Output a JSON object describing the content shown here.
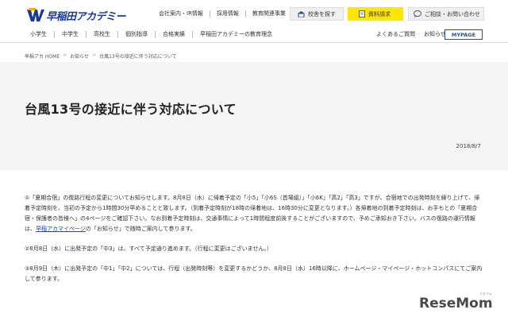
{
  "header": {
    "logo_text": "早稲田アカデミー",
    "top_links": [
      "会社案内・IR情報",
      "採用情報",
      "教育関連事業"
    ],
    "school_search_label": "校舎を探す",
    "material_label": "資料請求",
    "contact_label": "ご相談・お問い合わせ"
  },
  "nav": {
    "items": [
      "小学生",
      "中学生",
      "高校生",
      "個別指導",
      "合格実績",
      "早稲田アカデミーの教育理念"
    ],
    "sub_items": [
      "よくあるご質問",
      "お知らせ"
    ],
    "mypage_label": "MYPAGE"
  },
  "breadcrumb": {
    "items": [
      "早稲アカ HOME",
      "お知らせ",
      "台風13号の接近に伴う対応について"
    ]
  },
  "article": {
    "title": "台風13号の接近に伴う対応について",
    "date": "2018/8/7",
    "p1_before": "①「夏期合宿」の復路行程の変更についてお知らせします。8月8日（水）に帰着予定の「小5」「小6S（首場組）」「小6K」「高2」「高3」ですが、合宿地での出発時刻を繰り上げて、帰着予定時刻を、当初の予定から1時間30分早めることと致します。（到着予定時刻が18時の帰着地は、16時30分に変更となります。）各帰着地の到着予定時刻は、お手もとの「夏期合宿・保護者の皆様へ」の4ページをご確認下さい。なお到着予定時刻は、交通事情によって1時間程度前後することがございますので、予めご承知おき下さい。バスの復路の運行情報は、",
    "p1_link": "早稲アカマイページ",
    "p1_after": "の「お知らせ」で随時ご案内して参ります。",
    "p2": "②8月8日（水）に出発予定の「中3」は、すべて予定通り進めます。（行程に変更はございません。）",
    "p3": "③8月9日（木）に出発予定の「中1」「中2」については、行程（出発時刻等）を変更するかどうか、8月8日（水）16時以降に、ホームページ・マイページ・ホットコンパスにてご案内して参ります。"
  },
  "watermark": {
    "text": "ReseMom",
    "sub": "リセマム"
  },
  "colors": {
    "brand_blue": "#1a3b8f",
    "material_yellow": "#ffe600",
    "title_band": "#f5f5f5",
    "link_blue": "#1a44b8"
  }
}
